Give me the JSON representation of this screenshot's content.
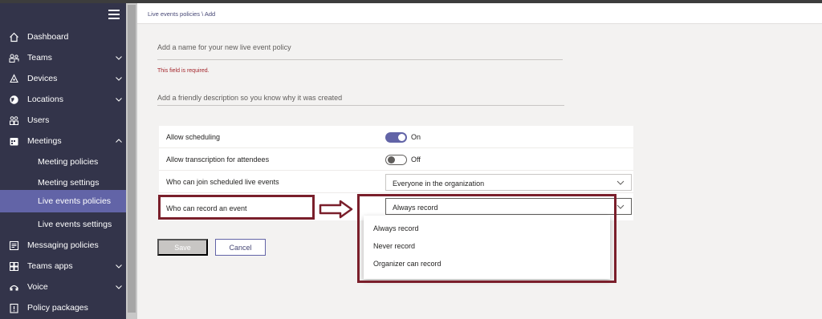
{
  "breadcrumb": "Live events policies \\ Add",
  "form": {
    "name_placeholder": "Add a name for your new live event policy",
    "name_error": "This field is required.",
    "description_placeholder": "Add a friendly description so you know why it was created"
  },
  "settings": {
    "allow_scheduling": {
      "label": "Allow scheduling",
      "state": "On"
    },
    "allow_transcription": {
      "label": "Allow transcription for attendees",
      "state": "Off"
    },
    "who_can_join": {
      "label": "Who can join scheduled live events",
      "value": "Everyone in the organization"
    },
    "who_can_record": {
      "label": "Who can record an event",
      "value": "Always record"
    }
  },
  "record_options": [
    "Always record",
    "Never record",
    "Organizer can record"
  ],
  "buttons": {
    "save": "Save",
    "cancel": "Cancel"
  },
  "sidebar": {
    "items": [
      {
        "label": "Dashboard",
        "icon": "home-icon"
      },
      {
        "label": "Teams",
        "icon": "teams-icon",
        "chevron": "down"
      },
      {
        "label": "Devices",
        "icon": "devices-icon",
        "chevron": "down"
      },
      {
        "label": "Locations",
        "icon": "globe-icon",
        "chevron": "down"
      },
      {
        "label": "Users",
        "icon": "users-icon"
      },
      {
        "label": "Meetings",
        "icon": "calendar-icon",
        "chevron": "up"
      },
      {
        "label": "Meeting policies"
      },
      {
        "label": "Meeting settings"
      },
      {
        "label": "Live events policies",
        "active": true
      },
      {
        "label": "Live events settings"
      },
      {
        "label": "Messaging policies",
        "icon": "message-icon"
      },
      {
        "label": "Teams apps",
        "icon": "apps-icon",
        "chevron": "down"
      },
      {
        "label": "Voice",
        "icon": "voice-icon",
        "chevron": "down"
      },
      {
        "label": "Policy packages",
        "icon": "policy-icon"
      }
    ]
  },
  "colors": {
    "sidebar": "#33344a",
    "accent": "#6264a7",
    "highlight": "#7a1f2b",
    "error": "#a4262c"
  }
}
